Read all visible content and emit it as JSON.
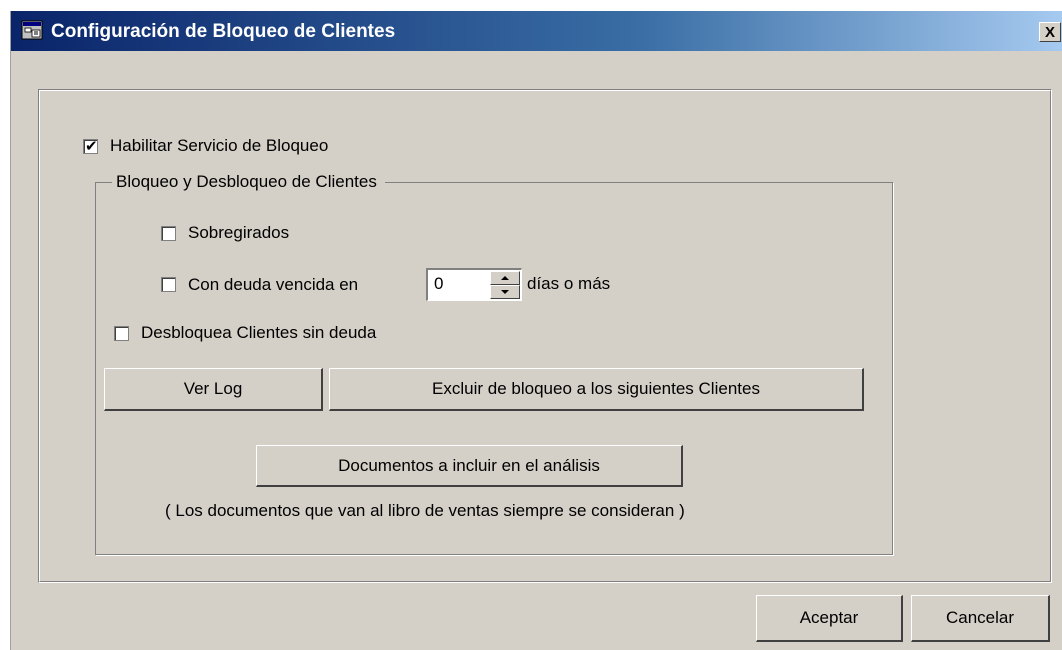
{
  "window": {
    "title": "Configuración de Bloqueo de Clientes",
    "close_label": "X",
    "title_icon": "app-window-icon"
  },
  "main": {
    "enable_service": {
      "label": "Habilitar Servicio de Bloqueo",
      "checked": true
    },
    "group": {
      "legend": "Bloqueo y Desbloqueo de Clientes",
      "overdrawn": {
        "label": "Sobregirados",
        "checked": false
      },
      "overdue_debt": {
        "label": "Con deuda vencida en",
        "checked": false,
        "days_value": "0",
        "suffix": "días o más"
      }
    },
    "unblock_no_debt": {
      "label": "Desbloquea Clientes sin deuda",
      "checked": false
    },
    "buttons": {
      "view_log": "Ver Log",
      "exclude_clients": "Excluir de bloqueo a los siguientes Clientes",
      "documents": "Documentos a incluir en el análisis"
    },
    "note": "( Los documentos que van al libro de ventas siempre se consideran )"
  },
  "footer": {
    "accept": "Aceptar",
    "cancel": "Cancelar"
  },
  "colors": {
    "window_bg": "#d4d0c8",
    "title_gradient_start": "#0a246a",
    "title_gradient_end": "#a6caf0"
  }
}
